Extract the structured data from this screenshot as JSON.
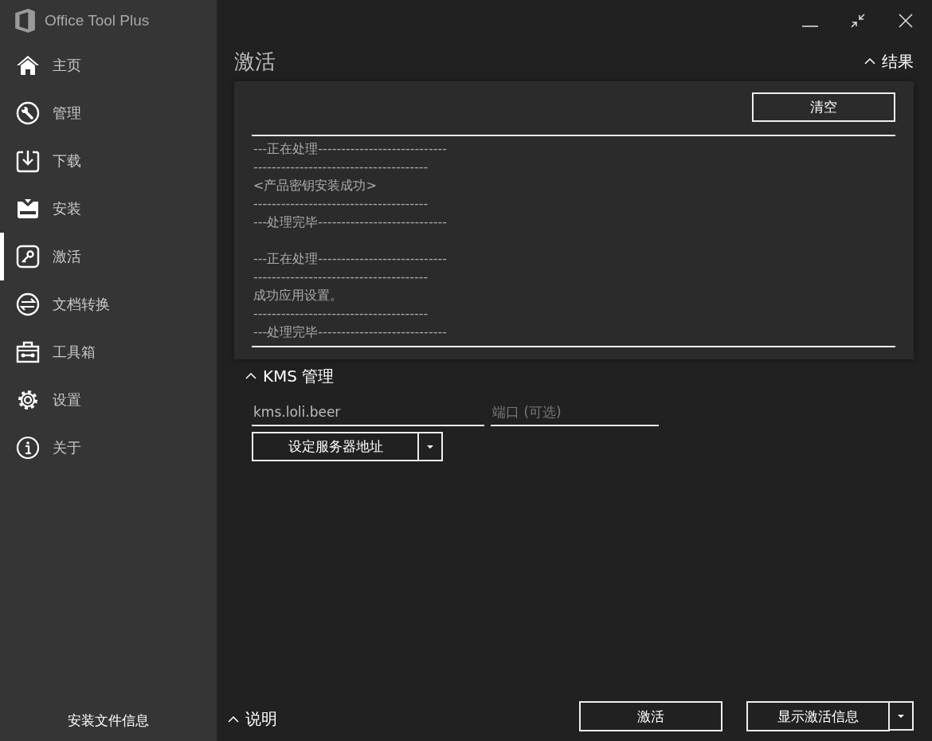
{
  "app": {
    "title": "Office Tool Plus"
  },
  "nav": [
    {
      "label": "主页",
      "kind": "home",
      "selected": false
    },
    {
      "label": "管理",
      "kind": "wrench",
      "selected": false
    },
    {
      "label": "下载",
      "kind": "download",
      "selected": false
    },
    {
      "label": "安装",
      "kind": "tray",
      "selected": false
    },
    {
      "label": "激活",
      "kind": "key",
      "selected": true
    },
    {
      "label": "文档转换",
      "kind": "swap",
      "selected": false
    },
    {
      "label": "工具箱",
      "kind": "toolbox",
      "selected": false
    },
    {
      "label": "设置",
      "kind": "gear",
      "selected": false
    },
    {
      "label": "关于",
      "kind": "info",
      "selected": false
    }
  ],
  "sidebar_footer": "安装文件信息",
  "page_title": "激活",
  "results": {
    "header": "结果",
    "clear_button": "清空",
    "log": [
      {
        "lines": [
          "---正在处理----------------------------",
          "--------------------------------------",
          "<产品密钥安装成功>",
          "--------------------------------------",
          "---处理完毕----------------------------"
        ]
      },
      {
        "lines": [
          "---正在处理----------------------------",
          "--------------------------------------",
          "成功应用设置。",
          "--------------------------------------",
          "---处理完毕----------------------------"
        ]
      }
    ]
  },
  "kms": {
    "header": "KMS 管理",
    "server": {
      "value": "kms.loli.beer"
    },
    "port": {
      "placeholder": "端口 (可选)"
    },
    "set_button": "设定服务器地址"
  },
  "notes": {
    "header": "说明"
  },
  "buttons": [
    {
      "label": "激活",
      "dropdown": false
    },
    {
      "label": "显示激活信息",
      "dropdown": true
    }
  ]
}
